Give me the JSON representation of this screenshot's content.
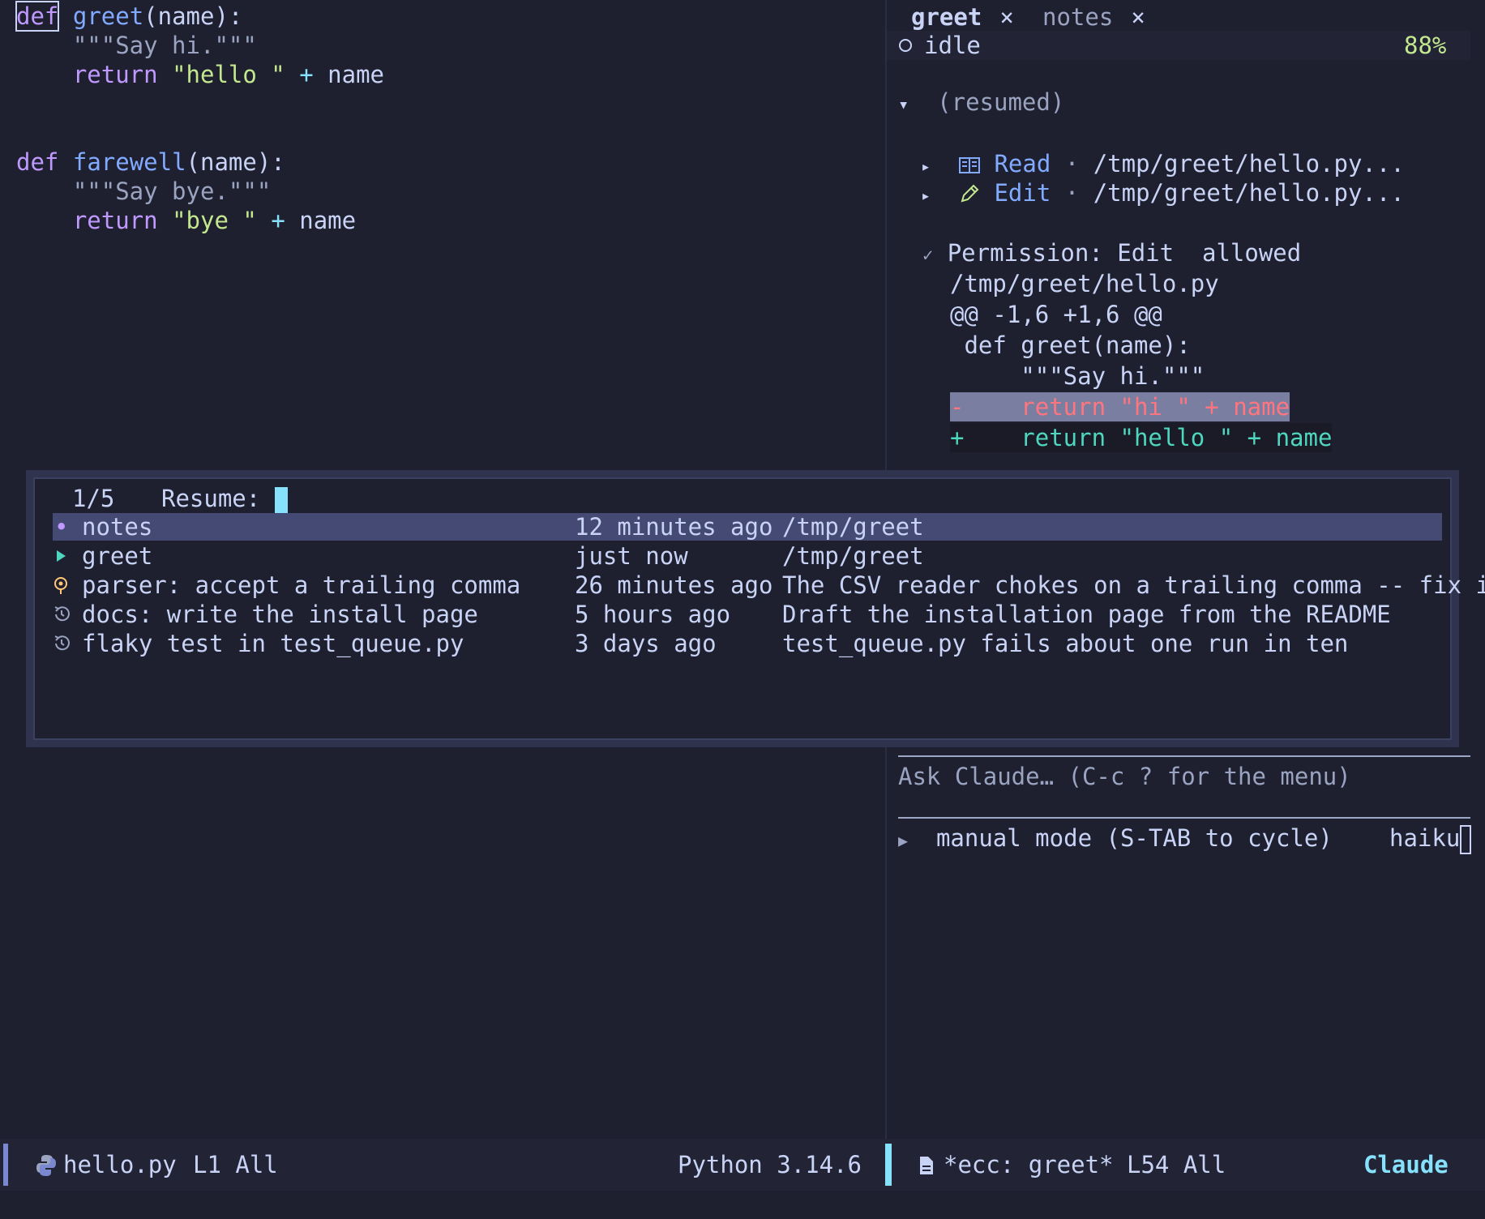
{
  "editor": {
    "lines": [
      {
        "kw": "def",
        "name": "greet",
        "rest": "(name):"
      },
      {
        "doc": "\"\"\"Say hi.\"\"\""
      },
      {
        "kw": "return",
        "str": "\"hello \"",
        "op": "+",
        "var": "name"
      },
      {
        "kw": "def",
        "name": "farewell",
        "rest": "(name):"
      },
      {
        "doc": "\"\"\"Say bye.\"\"\""
      },
      {
        "kw": "return",
        "str": "\"bye \"",
        "op": "+",
        "var": "name"
      }
    ]
  },
  "chat": {
    "tabs": [
      {
        "label": "greet",
        "close": "×",
        "active": true
      },
      {
        "label": "notes",
        "close": "×",
        "active": false
      }
    ],
    "status": {
      "state": "idle",
      "percent": "88%"
    },
    "section": {
      "toggle": "▾",
      "title": "(resumed)"
    },
    "tool_calls": [
      {
        "arrow": "▸",
        "name": "Read",
        "sep": "·",
        "path": "/tmp/greet/hello.py..."
      },
      {
        "arrow": "▸",
        "name": "Edit",
        "sep": "·",
        "path": "/tmp/greet/hello.py..."
      }
    ],
    "permission": {
      "check": "✓",
      "text": "Permission: Edit  allowed",
      "file": "/tmp/greet/hello.py",
      "hunk": "@@ -1,6 +1,6 @@",
      "ctx1": " def greet(name):",
      "ctx2": "     \"\"\"Say hi.\"\"\"",
      "del": "-    return \"hi \" + name",
      "add": "+    return \"hello \" + name"
    },
    "input_placeholder": "Ask Claude… (C-c ? for the menu)",
    "mode": {
      "arrow": "▶",
      "label": "manual mode (S-TAB to cycle)",
      "model": "haiku"
    }
  },
  "resume": {
    "counter": "1/5",
    "prompt": "Resume:",
    "items": [
      {
        "icon": "dot",
        "glyph": "•",
        "name": "notes",
        "time": "12 minutes ago",
        "desc": "/tmp/greet",
        "selected": true
      },
      {
        "icon": "play",
        "glyph": "",
        "name": "greet",
        "time": "just now",
        "desc": "/tmp/greet",
        "selected": false
      },
      {
        "icon": "pin",
        "glyph": "",
        "name": "parser: accept a trailing comma",
        "time": "26 minutes ago",
        "desc": "The CSV reader chokes on a trailing comma -- fix it",
        "selected": false
      },
      {
        "icon": "history",
        "glyph": "",
        "name": "docs: write the install page",
        "time": "5 hours ago",
        "desc": "Draft the installation page from the README",
        "selected": false
      },
      {
        "icon": "history",
        "glyph": "",
        "name": "flaky test in test_queue.py",
        "time": "3 days ago",
        "desc": "test_queue.py fails about one run in ten",
        "selected": false
      }
    ]
  },
  "modeline_left": {
    "file": "hello.py",
    "pos": "L1 All",
    "lang": "Python 3.14.6"
  },
  "modeline_right": {
    "buffer": "*ecc: greet*",
    "pos": "L54 All",
    "app": "Claude"
  },
  "colors": {
    "bg": "#1e2030",
    "keyword": "#c099ff",
    "function": "#82aaff",
    "string": "#c3e88d",
    "accent": "#86e1fc",
    "diff_del": "#ff757f",
    "diff_add": "#4fd6be"
  }
}
